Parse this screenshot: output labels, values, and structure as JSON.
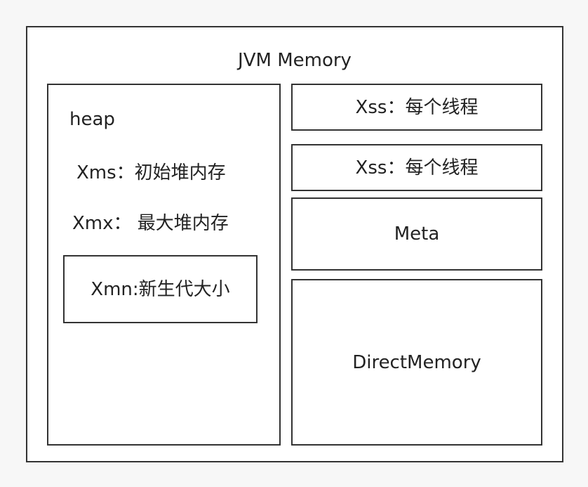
{
  "diagram": {
    "title": "JVM Memory",
    "heap": {
      "label": "heap",
      "xms": "Xms：初始堆内存",
      "xmx": "Xmx： 最大堆内存",
      "xmn": "Xmn:新生代大小"
    },
    "right_boxes": {
      "xss_1": "Xss：每个线程",
      "xss_2": "Xss：每个线程",
      "meta": "Meta",
      "direct_memory": "DirectMemory"
    }
  }
}
